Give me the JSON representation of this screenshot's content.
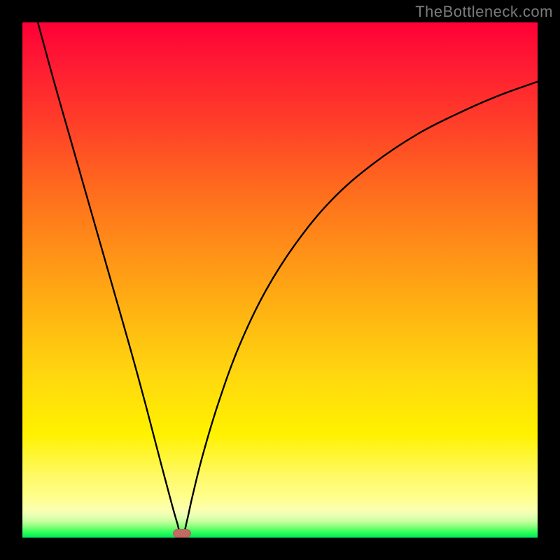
{
  "watermark": "TheBottleneck.com",
  "chart_data": {
    "type": "line",
    "title": "",
    "xlabel": "",
    "ylabel": "",
    "xlim": [
      0,
      100
    ],
    "ylim": [
      0,
      100
    ],
    "grid": false,
    "legend": false,
    "min_point": {
      "x": 31,
      "y": 0
    },
    "marker": {
      "x_pct": 31,
      "y_pct": 99.2,
      "color": "#c36a62"
    },
    "series": [
      {
        "name": "bottleneck-curve",
        "x": [
          3,
          6,
          9,
          12,
          15,
          18,
          21,
          24,
          27,
          29,
          30,
          31,
          32,
          33,
          35,
          38,
          42,
          47,
          53,
          60,
          68,
          77,
          86,
          93,
          100
        ],
        "y": [
          100,
          89,
          78.5,
          68,
          57.5,
          47,
          36.5,
          25.5,
          14,
          6.5,
          3,
          0,
          3.5,
          8,
          16,
          26,
          37,
          47.5,
          57,
          65.5,
          72.5,
          78.5,
          83,
          86,
          88.5
        ]
      }
    ],
    "colors": {
      "curve": "#000000",
      "background_top": "#ff0036",
      "background_bottom": "#00e85a"
    }
  }
}
